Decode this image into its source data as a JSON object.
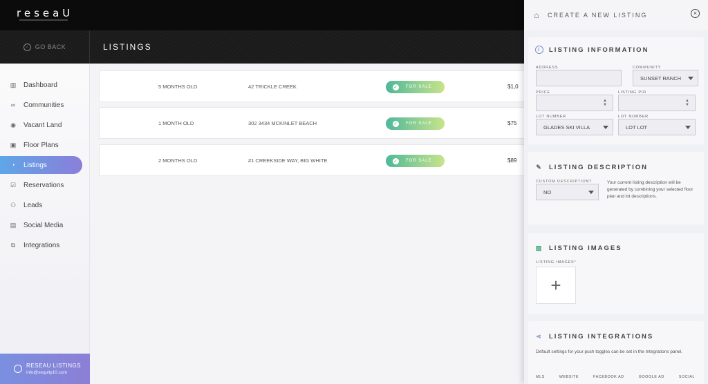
{
  "app": {
    "logo": "reseaU",
    "go_back": "GO BACK",
    "page_title": "LISTINGS"
  },
  "sidebar": {
    "items": [
      {
        "label": "Dashboard",
        "icon": "dashboard-icon"
      },
      {
        "label": "Communities",
        "icon": "communities-icon"
      },
      {
        "label": "Vacant Land",
        "icon": "vacant-land-icon"
      },
      {
        "label": "Floor Plans",
        "icon": "floor-plans-icon"
      },
      {
        "label": "Listings",
        "icon": "listings-icon",
        "active": true
      },
      {
        "label": "Reservations",
        "icon": "reservations-icon"
      },
      {
        "label": "Leads",
        "icon": "leads-icon"
      },
      {
        "label": "Social Media",
        "icon": "social-media-icon"
      },
      {
        "label": "Integrations",
        "icon": "integrations-icon"
      }
    ],
    "account": {
      "name": "RESEAU LISTINGS",
      "email": "info@xequity10.com"
    }
  },
  "listings": {
    "rows": [
      {
        "age": "5 MONTHS OLD",
        "address": "42 TRICKLE CREEK",
        "status": "FOR SALE",
        "price": "$1,0"
      },
      {
        "age": "1 MONTH OLD",
        "address": "302 3434 MCKINLET BEACH",
        "status": "FOR SALE",
        "price": "$75"
      },
      {
        "age": "2 MONTHS OLD",
        "address": "#1 CREEKSIDE WAY, BIG WHITE",
        "status": "FOR SALE",
        "price": "$89"
      }
    ],
    "status_color_start": "#4fb89a",
    "status_color_end": "#c8e48a"
  },
  "panel": {
    "title": "CREATE A NEW LISTING",
    "info": {
      "title": "LISTING INFORMATION",
      "address_label": "ADDRESS",
      "address_value": "",
      "community_label": "COMMUNITY",
      "community_value": "SUNSET RANCH",
      "price_label": "PRICE",
      "price_value": "",
      "pid_label": "LISTING PID",
      "pid_value": "",
      "lot1_label": "LOT NUMBER",
      "lot1_value": "GLADES SKI VILLA",
      "lot2_label": "LOT NUMBER",
      "lot2_value": "LOT LOT"
    },
    "description": {
      "title": "LISTING DESCRIPTION",
      "custom_label": "CUSTOM DESCRIPTION?",
      "custom_value": "NO",
      "note": "Your current listing description will be generated by combining your selected floor plan and lot descriptions."
    },
    "images": {
      "title": "LISTING IMAGES",
      "label": "LISTING IMAGES*",
      "add": "+"
    },
    "integrations": {
      "title": "LISTING INTEGRATIONS",
      "note": "Default settings for your push toggles can be set in the Integrations panel.",
      "columns": [
        "MLS",
        "WEBSITE",
        "FACEBOOK AD",
        "GOOGLE AD",
        "SOCIAL"
      ]
    }
  },
  "colors": {
    "accent_start": "#5fa6e8",
    "accent_end": "#8a7ed9"
  }
}
